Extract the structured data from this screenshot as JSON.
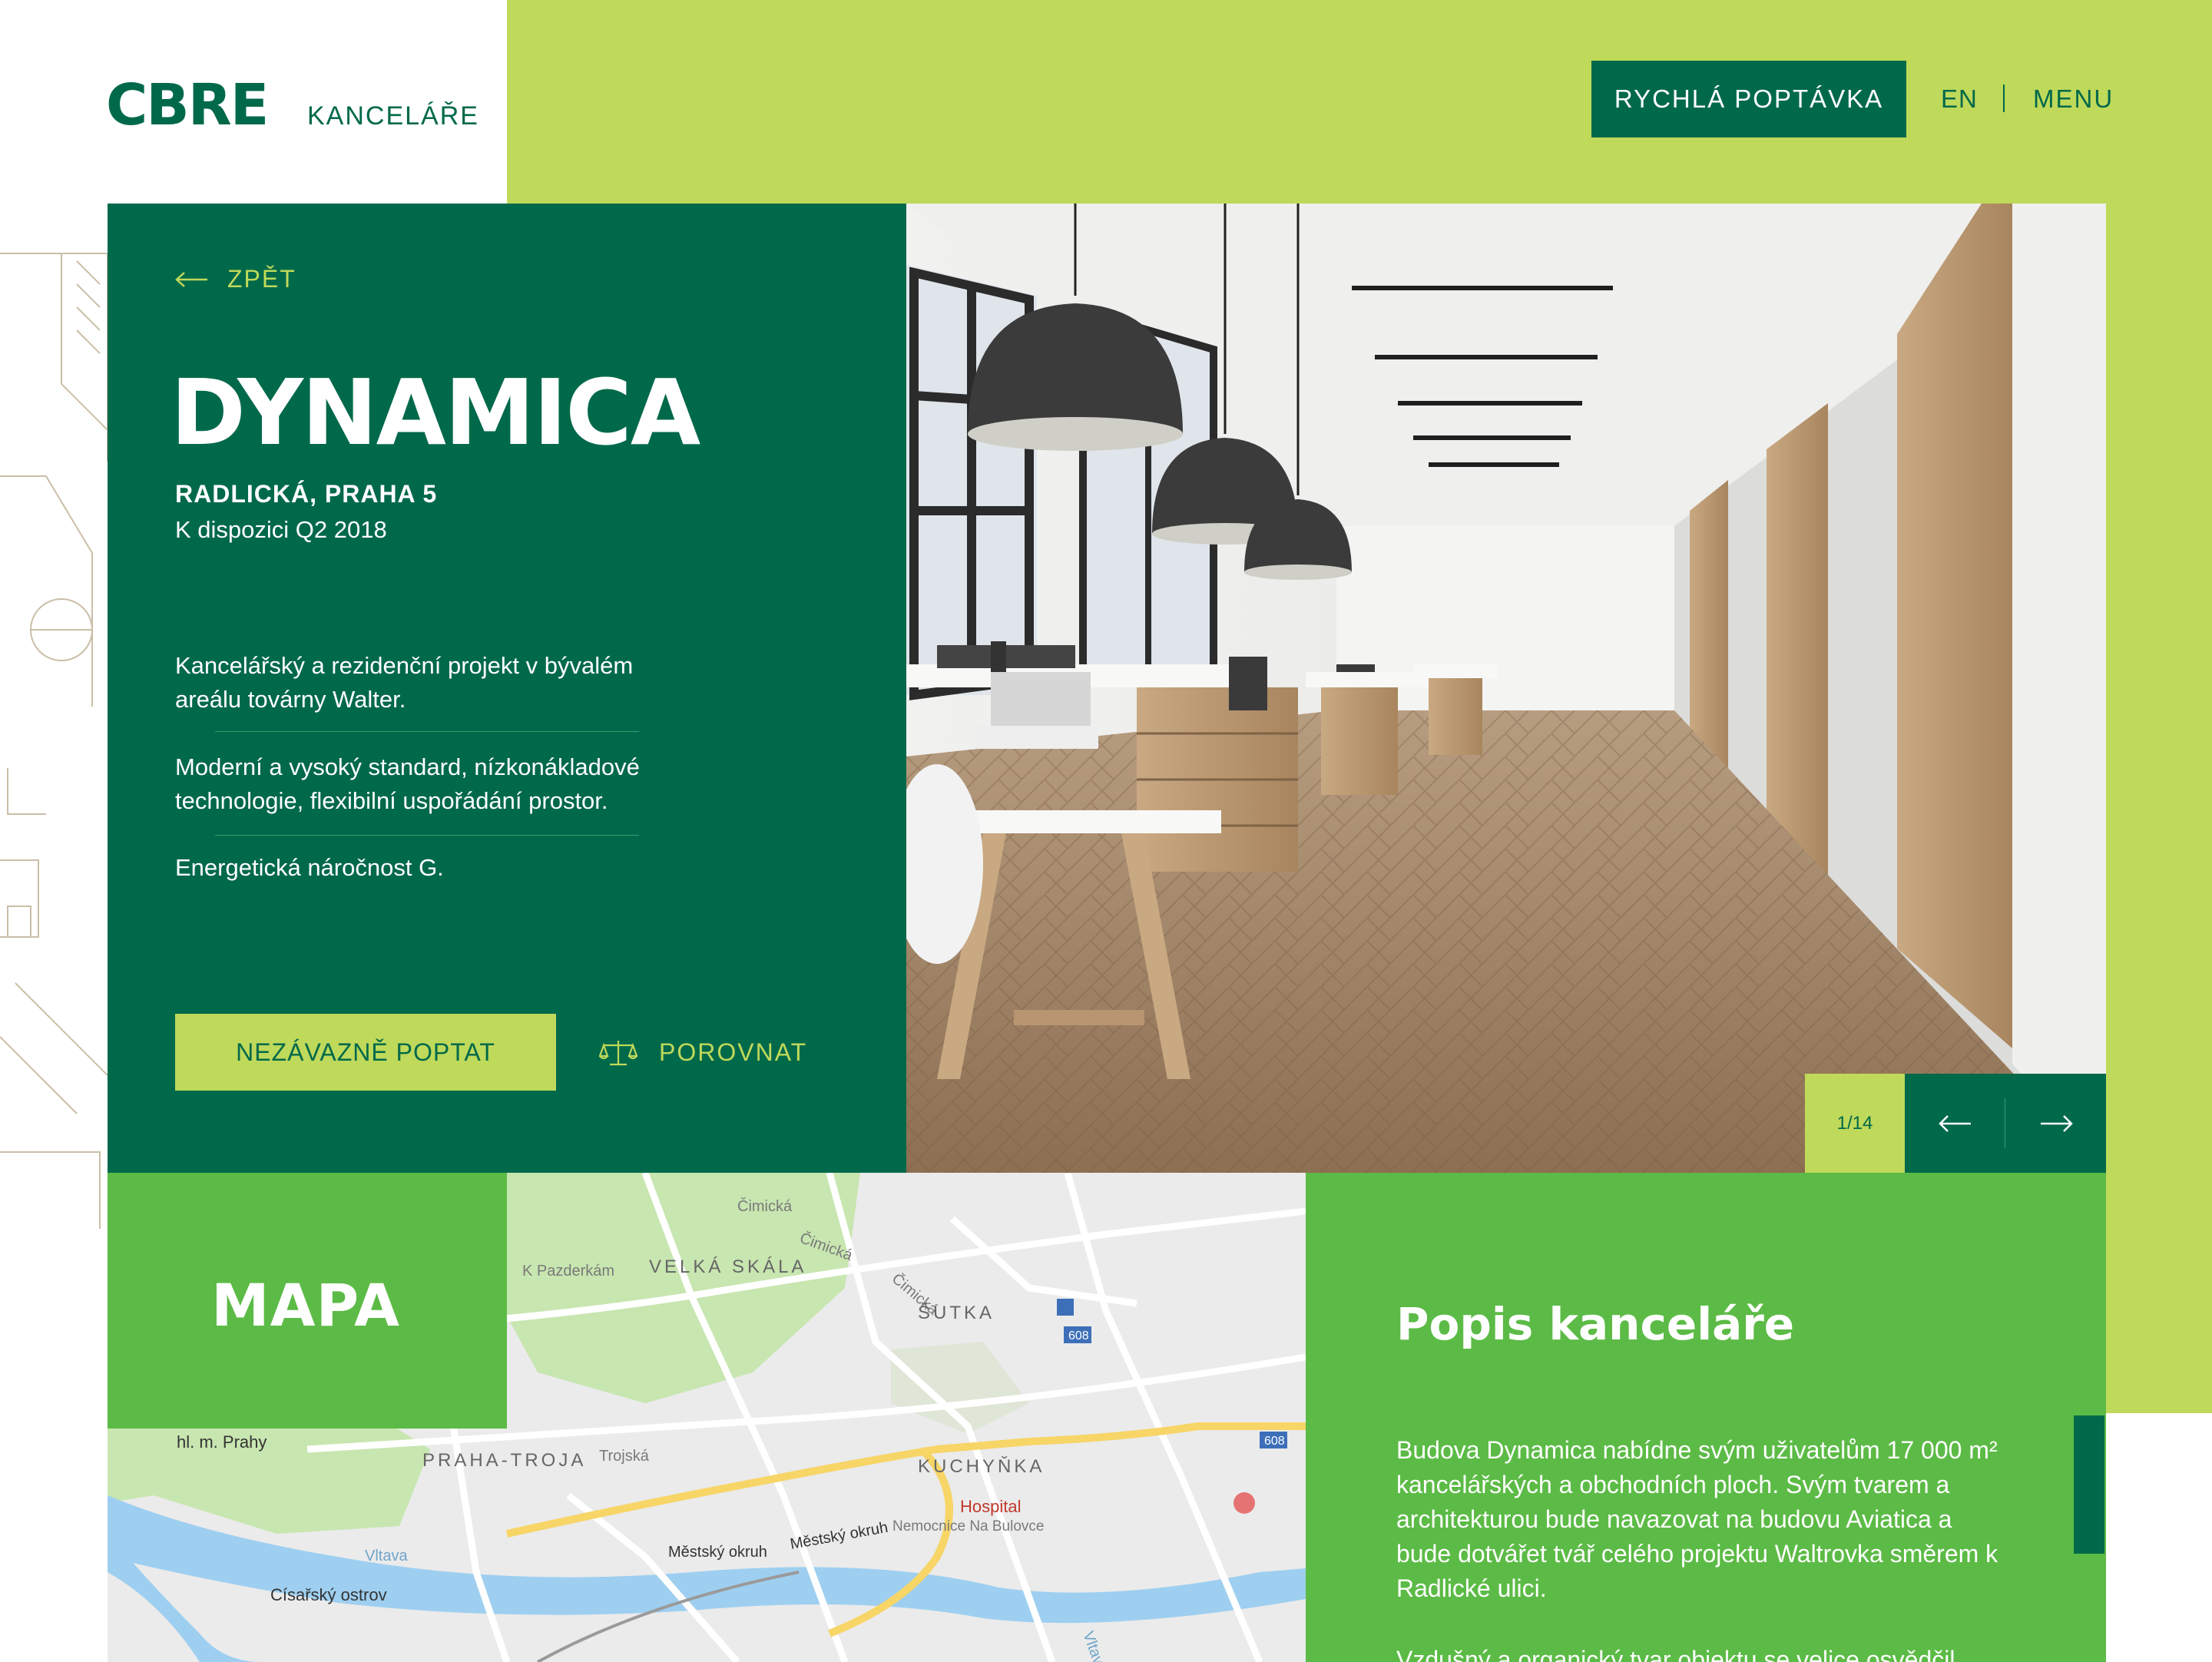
{
  "header": {
    "logo": "CBRE",
    "logo_sub": "KANCELÁŘE",
    "quick_inquiry": "RYCHLÁ POPTÁVKA",
    "lang": "EN",
    "menu": "MENU"
  },
  "hero": {
    "back": "ZPĚT",
    "title": "DYNAMICA",
    "address": "RADLICKÁ, PRAHA 5",
    "availability": "K dispozici Q2 2018",
    "features": [
      "Kancelářský a rezidenční projekt v bývalém areálu továrny Walter.",
      "Moderní a vysoký standard, nízkonákladové technologie, flexibilní uspořádání prostor.",
      "Energetická náročnost G."
    ],
    "inquiry_button": "NEZÁVAZNĚ POPTAT",
    "compare": "POROVNAT"
  },
  "gallery": {
    "counter": "1/14"
  },
  "map": {
    "title": "MAPA",
    "labels": {
      "cimicka1": "Čimická",
      "cimicka2": "Čimická",
      "cimicka3": "Čimická",
      "k_pazderkam": "K Pazderkám",
      "velka_skala": "VELKÁ SKÁLA",
      "sutka": "ŠUTKA",
      "road608a": "608",
      "road608b": "608",
      "hl_prahy": "hl. m. Prahy",
      "praha_troja": "PRAHA-TROJA",
      "trojska": "Trojská",
      "kuchynka": "KUCHYŇKA",
      "hospital": "Hospital",
      "nemocnice": "Nemocnice Na Bulovce",
      "vltava1": "Vltava",
      "vltava2": "Vltava",
      "mestsky1": "Městský okruh",
      "mestsky2": "Městský okruh",
      "cisarsky": "Císařský ostrov"
    }
  },
  "description": {
    "title": "Popis kanceláře",
    "paragraph1": "Budova Dynamica nabídne svým uživatelům 17 000 m² kancelářských a obchodních ploch. Svým tvarem a architekturou bude navazovat na budovu Aviatica a bude dotvářet tvář celého projektu Waltrovka směrem k Radlické ulici.",
    "paragraph2": "Vzdušný a organický tvar objektu se velice osvědčil"
  }
}
